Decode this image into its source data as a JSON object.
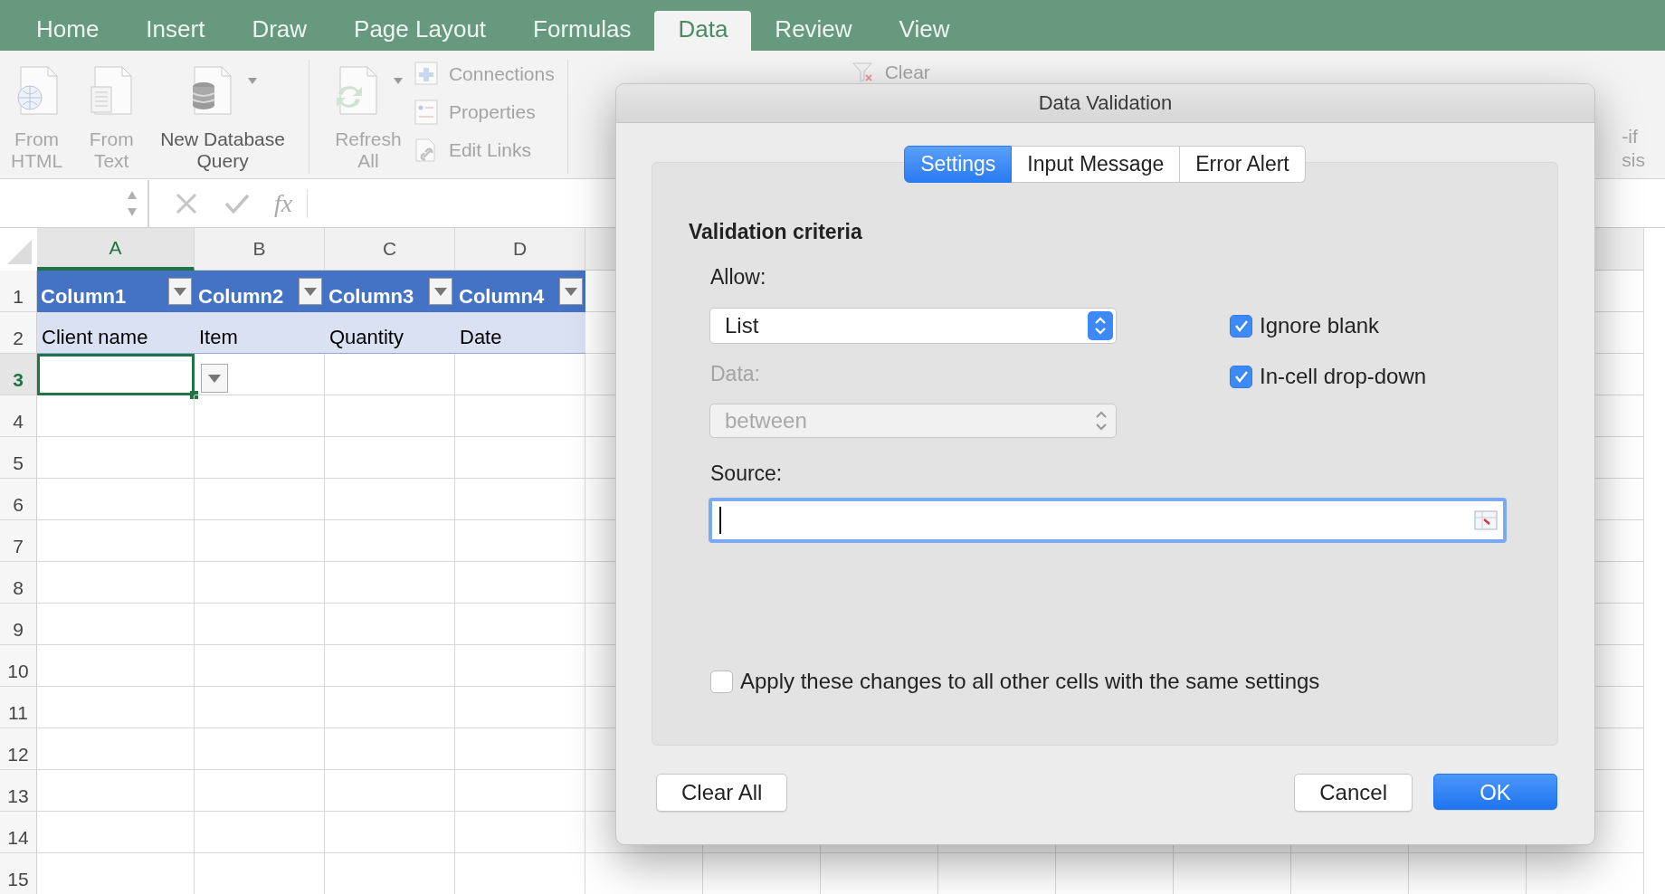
{
  "ribbon_tabs": [
    {
      "label": "Home",
      "selected": false
    },
    {
      "label": "Insert",
      "selected": false
    },
    {
      "label": "Draw",
      "selected": false
    },
    {
      "label": "Page Layout",
      "selected": false
    },
    {
      "label": "Formulas",
      "selected": false
    },
    {
      "label": "Data",
      "selected": true
    },
    {
      "label": "Review",
      "selected": false
    },
    {
      "label": "View",
      "selected": false
    }
  ],
  "ribbon": {
    "large_buttons": [
      {
        "kind": "globe",
        "lines": [
          "From",
          "HTML"
        ],
        "disabled": true,
        "menu": false
      },
      {
        "kind": "text",
        "lines": [
          "From",
          "Text"
        ],
        "disabled": true,
        "menu": false
      },
      {
        "kind": "database",
        "lines": [
          "New Database",
          "Query"
        ],
        "disabled": false,
        "menu": true
      },
      {
        "kind": "refresh",
        "lines": [
          "Refresh",
          "All"
        ],
        "disabled": true,
        "menu": true
      }
    ],
    "small_buttons": [
      {
        "kind": "connections",
        "label": "Connections",
        "disabled": true
      },
      {
        "kind": "properties",
        "label": "Properties",
        "disabled": true
      },
      {
        "kind": "links",
        "label": "Edit Links",
        "disabled": true
      }
    ],
    "clear_button": {
      "label": "Clear",
      "disabled": true
    },
    "what_if_fragments": [
      "-if",
      "sis"
    ]
  },
  "formula_bar": {
    "fx_label": "fx"
  },
  "sheet": {
    "columns": [
      {
        "label": "A",
        "selected": true
      },
      {
        "label": "B",
        "selected": false
      },
      {
        "label": "C",
        "selected": false
      },
      {
        "label": "D",
        "selected": false
      }
    ],
    "rows": [
      {
        "label": "1",
        "selected": false
      },
      {
        "label": "2",
        "selected": false
      },
      {
        "label": "3",
        "selected": true
      },
      {
        "label": "4",
        "selected": false
      },
      {
        "label": "5",
        "selected": false
      },
      {
        "label": "6",
        "selected": false
      },
      {
        "label": "7",
        "selected": false
      },
      {
        "label": "8",
        "selected": false
      },
      {
        "label": "9",
        "selected": false
      },
      {
        "label": "10",
        "selected": false
      },
      {
        "label": "11",
        "selected": false
      },
      {
        "label": "12",
        "selected": false
      },
      {
        "label": "13",
        "selected": false
      },
      {
        "label": "14",
        "selected": false
      },
      {
        "label": "15",
        "selected": false
      }
    ],
    "table_headers": [
      "Column1",
      "Column2",
      "Column3",
      "Column4"
    ],
    "table_row": [
      "Client name",
      "Item",
      "Quantity",
      "Date"
    ]
  },
  "dialog": {
    "title": "Data Validation",
    "tabs": [
      {
        "label": "Settings",
        "selected": true
      },
      {
        "label": "Input Message",
        "selected": false
      },
      {
        "label": "Error Alert",
        "selected": false
      }
    ],
    "section_title": "Validation criteria",
    "allow": {
      "label": "Allow:",
      "value": "List"
    },
    "data": {
      "label": "Data:",
      "value": "between",
      "disabled": true
    },
    "options": [
      {
        "label": "Ignore blank",
        "checked": true
      },
      {
        "label": "In-cell drop-down",
        "checked": true
      }
    ],
    "source": {
      "label": "Source:"
    },
    "apply": {
      "label": "Apply these changes to all other cells with the same settings",
      "checked": false
    },
    "buttons": [
      {
        "label": "Clear All",
        "kind": "plain"
      },
      {
        "label": "Cancel",
        "kind": "plain"
      },
      {
        "label": "OK",
        "kind": "default"
      }
    ]
  }
}
